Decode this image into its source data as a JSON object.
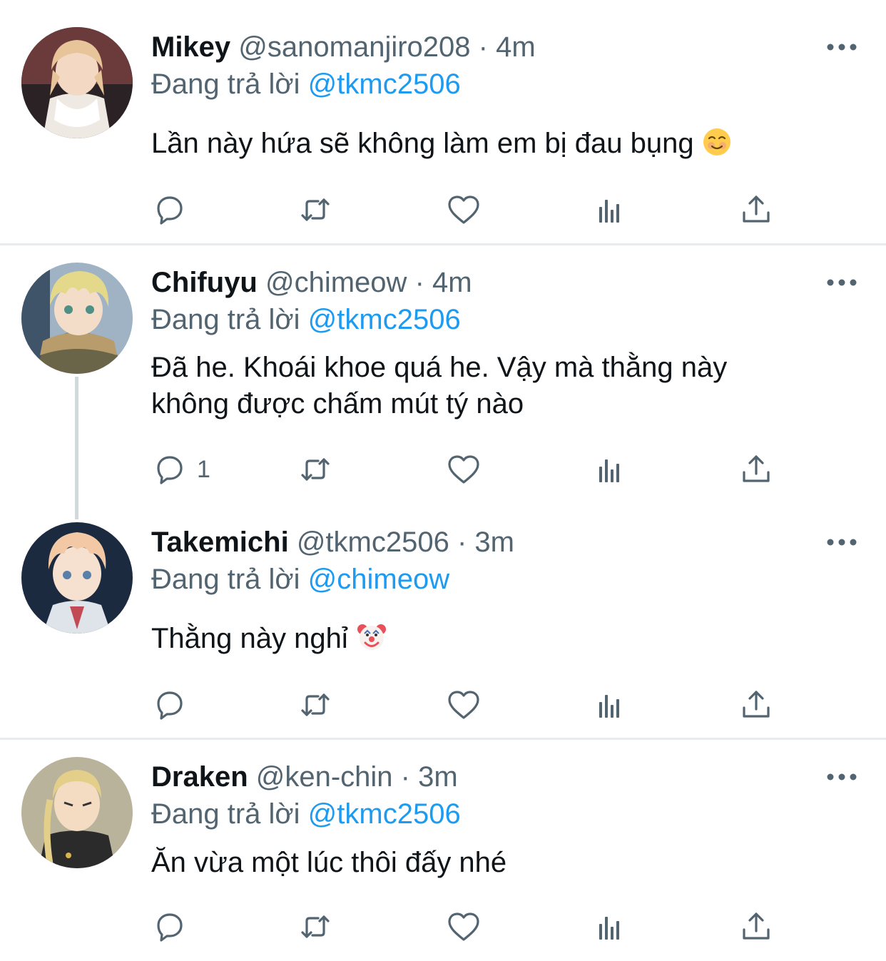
{
  "tweets": [
    {
      "name": "Mikey",
      "handle": "@sanomanjiro208",
      "dot": "·",
      "time": "4m",
      "replying_prefix": "Đang trả lời",
      "replying_to": "@tkmc2506",
      "text": "Lần này hứa sẽ không làm em bị đau bụng",
      "emoji": "smiling-face-emoji",
      "reply_count": ""
    },
    {
      "name": "Chifuyu",
      "handle": "@chimeow",
      "dot": "·",
      "time": "4m",
      "replying_prefix": "Đang trả lời",
      "replying_to": "@tkmc2506",
      "text_line1": "Đã he. Khoái khoe quá he. Vậy mà thằng này",
      "text_line2": "không được chấm mút tý nào",
      "reply_count": "1"
    },
    {
      "name": "Takemichi",
      "handle": "@tkmc2506",
      "dot": "·",
      "time": "3m",
      "replying_prefix": "Đang trả lời",
      "replying_to": "@chimeow",
      "text": "Thằng này nghỉ",
      "emoji": "clown-face-emoji",
      "reply_count": ""
    },
    {
      "name": "Draken",
      "handle": "@ken-chin",
      "dot": "·",
      "time": "3m",
      "replying_prefix": "Đang trả lời",
      "replying_to": "@tkmc2506",
      "text": "Ăn vừa một lúc thôi đấy nhé",
      "reply_count": ""
    }
  ],
  "icons": {
    "reply": "reply-icon",
    "retweet": "retweet-icon",
    "like": "heart-icon",
    "analytics": "analytics-icon",
    "share": "share-icon",
    "more": "more-icon"
  },
  "colors": {
    "text": "#0f1419",
    "secondary": "#536471",
    "accent": "#1d9bf0",
    "divider": "#e6ecf0"
  }
}
